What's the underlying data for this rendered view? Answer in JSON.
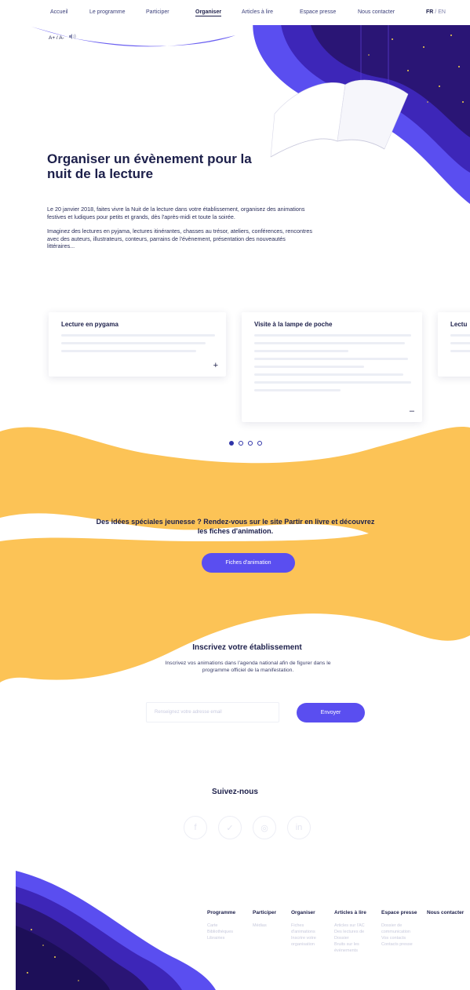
{
  "nav": {
    "items": [
      "Accueil",
      "Le programme",
      "Participer",
      "Organiser",
      "Articles à lire",
      "Espace presse",
      "Nous contacter"
    ],
    "active": "Organiser",
    "lang_active": "FR",
    "lang_sep": " / ",
    "lang_other": "EN"
  },
  "accessibility": {
    "text_size": "A+ / A-",
    "sound_icon": "speaker-icon"
  },
  "hero": {
    "title": "Organiser un évènement pour la nuit de la lecture",
    "paragraphs": [
      "Le 20 janvier 2018, faites vivre la Nuit de la lecture dans votre établissement, organisez des animations festives et ludiques pour petits et grands, dès l'après-midi et toute la soirée.",
      "Imaginez des lectures en pyjama, lectures itinérantes, chasses au trésor, ateliers, conférences, rencontres avec des auteurs, illustrateurs, conteurs, parrains de l'évènement, présentation des nouveautés littéraires..."
    ]
  },
  "cards": [
    {
      "title": "Lecture en pygama",
      "toggle": "+"
    },
    {
      "title": "Visite à la lampe de poche",
      "toggle": "–"
    },
    {
      "title": "Lectu",
      "toggle": ""
    }
  ],
  "carousel": {
    "count": 4,
    "active": 0
  },
  "promo": {
    "text": "Des idées spéciales jeunesse ? Rendez-vous sur le site Partir en livre et découvrez les fiches d'animation.",
    "button": "Fiches d'animation"
  },
  "register": {
    "title": "Inscrivez votre établissement",
    "text": "Inscrivez vos animations dans l'agenda national afin de figurer dans le programme officiel de la manifestation.",
    "email_placeholder": "Renseignez votre adresse email",
    "submit": "Envoyer"
  },
  "social": {
    "title": "Suivez-nous",
    "icons": [
      "facebook-icon",
      "twitter-icon",
      "instagram-icon",
      "linkedin-icon"
    ]
  },
  "footer": {
    "columns": [
      {
        "title": "Programme",
        "items": [
          "Carte",
          "Bibliothèques",
          "Librairies"
        ]
      },
      {
        "title": "Participer",
        "items": [
          "Médias"
        ]
      },
      {
        "title": "Organiser",
        "items": [
          "Fiches",
          "d'animations",
          "Inscrire votre",
          "organisation"
        ]
      },
      {
        "title": "Articles à lire",
        "items": [
          "Articles sur l'AC",
          "Des lectures de",
          "Dossier",
          "Bruits sur les",
          "évènements"
        ]
      },
      {
        "title": "Espace presse",
        "items": [
          "Dossier de",
          "communication",
          "Vos contacts",
          "Contacts presse"
        ]
      },
      {
        "title": "Nous contacter",
        "items": []
      }
    ]
  },
  "colors": {
    "brand_purple": "#5a4ef0",
    "navy": "#1c1f4a",
    "yellow": "#fcc356",
    "deep_purple": "#2a1575"
  }
}
